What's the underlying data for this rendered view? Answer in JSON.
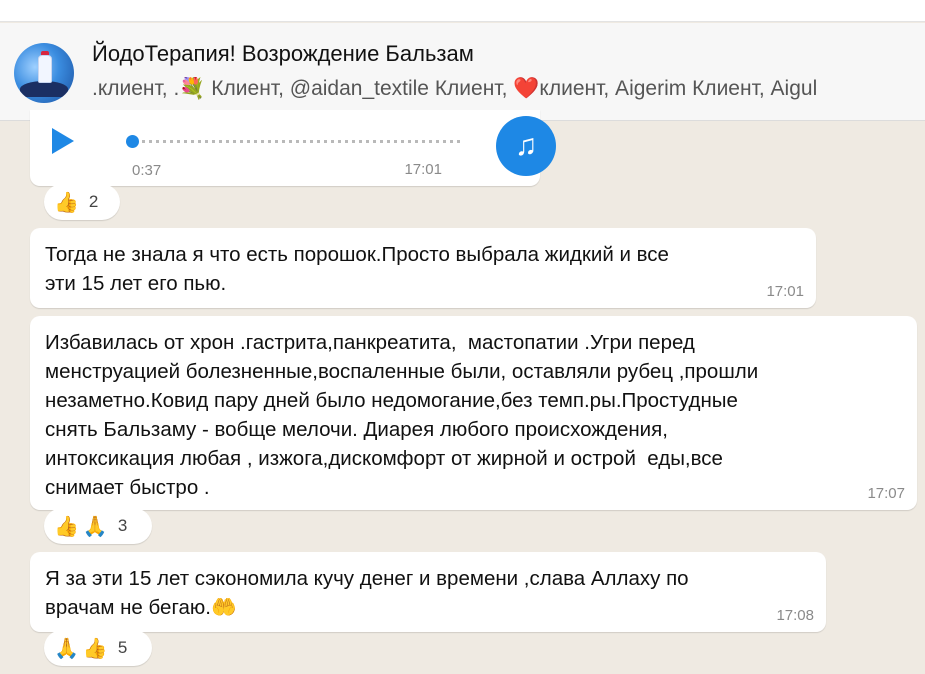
{
  "header": {
    "title": "ЙодоТерапия! Возрождение Бальзам",
    "subtitle": ".клиент, .💐 Клиент, @aidan_textile Клиент, ❤️клиент, Aigerim Клиент, Aigul"
  },
  "audio": {
    "duration": "0:37",
    "time": "17:01"
  },
  "reactions1": {
    "emojis": [
      "👍"
    ],
    "count": "2"
  },
  "messages": [
    {
      "text": "Тогда не знала я что есть порошок.Просто выбрала жидкий и все\nэти 15 лет его пью.",
      "time": "17:01"
    },
    {
      "text": "Избавилась от хрон .гастрита,панкреатита,  мастопатии .Угри перед\nменструацией болезненные,воспаленные были, оставляли рубец ,прошли\nнезаметно.Ковид пару дней было недомогание,без темп.ры.Простудные\nснять Бальзаму - вобще мелочи. Диарея любого происхождения,\nинтоксикация любая , изжога,дискомфорт от жирной и острой  еды,все\nснимает быстро .",
      "time": "17:07"
    },
    {
      "text": "Я за эти 15 лет сэкономила кучу денег и времени ,слава Аллаху по\nврачам не бегаю.🤲",
      "time": "17:08"
    }
  ],
  "reactions2": {
    "emojis": [
      "👍",
      "🙏"
    ],
    "count": "3"
  },
  "reactions3": {
    "emojis": [
      "🙏",
      "👍"
    ],
    "count": "5"
  },
  "colors": {
    "accent": "#1e88e5",
    "background": "#efeae2",
    "bubble": "#ffffff"
  },
  "icons": {
    "play": "play-icon",
    "music": "music-note-icon"
  }
}
